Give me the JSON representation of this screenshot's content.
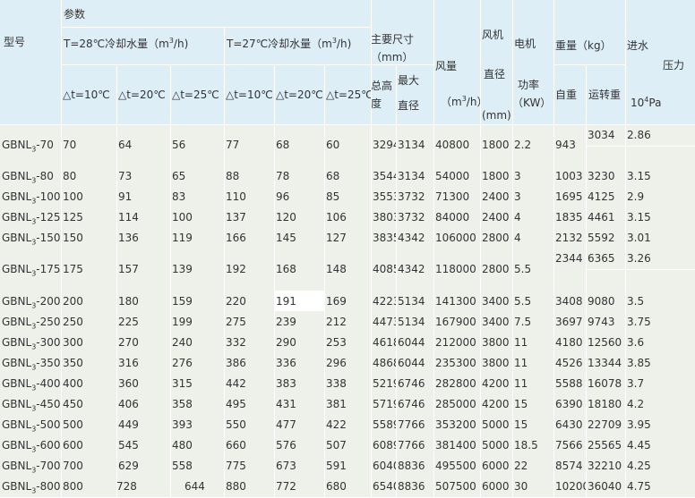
{
  "header": {
    "model": "型号",
    "params": "参数",
    "t28_prefix": "T=28℃冷却水量（m",
    "t28_suffix": "/h)",
    "t27_prefix": "T=27℃冷却水量（m",
    "t27_suffix": "/h)",
    "sup3": "3",
    "dt10": "△t=10℃",
    "dt20": "△t=20℃",
    "dt25": "△t=25℃",
    "main_size_1": "主要尺寸",
    "main_size_2": "（mm）",
    "total_height_1": "总高",
    "total_height_2": "度",
    "max_1": "最大",
    "max_2": "直径",
    "airflow_1": "风量",
    "airflow_2": "（m",
    "airflow_3": "/h）",
    "fan_1": "风机",
    "fan_2": "直径",
    "fan_3": "(mm)",
    "motor_1": "电机",
    "motor_2": "功率",
    "motor_3": "（KW）",
    "weight_1": "重量（kg）",
    "weight_self": "自重",
    "weight_run": "运转重",
    "inlet_1": "进水",
    "inlet_2": "压力",
    "inlet_3a": "10",
    "inlet_3sup": "4",
    "inlet_3b": "Pa"
  },
  "rows": [
    {
      "model": "GBNL3-70",
      "t28_10": "70",
      "t28_20": "64",
      "t28_25": "56",
      "t27_10": "77",
      "t27_20": "68",
      "t27_25": "60",
      "height": "3294",
      "diameter": "3134",
      "airflow": "40800",
      "fan_dia": "1800",
      "power": "2.2",
      "self_wt": "943",
      "run_wt": "3034",
      "pressure": "2.86"
    },
    {
      "model": "GBNL3-80",
      "t28_10": "80",
      "t28_20": "73",
      "t28_25": "65",
      "t27_10": "88",
      "t27_20": "78",
      "t27_25": "68",
      "height": "3544",
      "diameter": "3134",
      "airflow": "54000",
      "fan_dia": "1800",
      "power": "3",
      "self_wt": "1003",
      "run_wt": "3230",
      "pressure": "3.15"
    },
    {
      "model": "GBNL3-100",
      "t28_10": "100",
      "t28_20": "91",
      "t28_25": "83",
      "t27_10": "110",
      "t27_20": "96",
      "t27_25": "85",
      "height": "3553",
      "diameter": "3732",
      "airflow": "71300",
      "fan_dia": "2400",
      "power": "3",
      "self_wt": "1695",
      "run_wt": "4125",
      "pressure": "2.9"
    },
    {
      "model": "GBNL3-125",
      "t28_10": "125",
      "t28_20": "114",
      "t28_25": "100",
      "t27_10": "137",
      "t27_20": "120",
      "t27_25": "106",
      "height": "3803",
      "diameter": "3732",
      "airflow": "84000",
      "fan_dia": "2400",
      "power": "4",
      "self_wt": "1835",
      "run_wt": "4461",
      "pressure": "3.15"
    },
    {
      "model": "GBNL3-150",
      "t28_10": "150",
      "t28_20": "136",
      "t28_25": "119",
      "t27_10": "166",
      "t27_20": "145",
      "t27_25": "127",
      "height": "3835",
      "diameter": "4342",
      "airflow": "106000",
      "fan_dia": "2800",
      "power": "4",
      "self_wt": "2132",
      "run_wt": "5592",
      "pressure": "3.01"
    },
    {
      "model": "GBNL3-175",
      "t28_10": "175",
      "t28_20": "157",
      "t28_25": "139",
      "t27_10": "192",
      "t27_20": "168",
      "t27_25": "148",
      "height": "4085",
      "diameter": "4342",
      "airflow": "118000",
      "fan_dia": "2800",
      "power": "5.5",
      "self_wt": "2344",
      "run_wt": "6365",
      "pressure": "3.26"
    },
    {
      "model": "GBNL3-200",
      "t28_10": "200",
      "t28_20": "180",
      "t28_25": "159",
      "t27_10": "220",
      "t27_20": "191",
      "t27_25": "169",
      "height": "4223",
      "diameter": "5134",
      "airflow": "141300",
      "fan_dia": "3400",
      "power": "5.5",
      "self_wt": "3408",
      "run_wt": "9080",
      "pressure": "3.5"
    },
    {
      "model": "GBNL3-250",
      "t28_10": "250",
      "t28_20": "225",
      "t28_25": "199",
      "t27_10": "275",
      "t27_20": "239",
      "t27_25": "212",
      "height": "4473",
      "diameter": "5134",
      "airflow": "167900",
      "fan_dia": "3400",
      "power": "7.5",
      "self_wt": "3697",
      "run_wt": "9743",
      "pressure": "3.75"
    },
    {
      "model": "GBNL3-300",
      "t28_10": "300",
      "t28_20": "270",
      "t28_25": "240",
      "t27_10": "332",
      "t27_20": "290",
      "t27_25": "253",
      "height": "4618",
      "diameter": "6044",
      "airflow": "212000",
      "fan_dia": "3800",
      "power": "11",
      "self_wt": "4180",
      "run_wt": "12560",
      "pressure": "3.6"
    },
    {
      "model": "GBNL3-350",
      "t28_10": "350",
      "t28_20": "316",
      "t28_25": "276",
      "t27_10": "386",
      "t27_20": "336",
      "t27_25": "296",
      "height": "4868",
      "diameter": "6044",
      "airflow": "235300",
      "fan_dia": "3800",
      "power": "11",
      "self_wt": "4526",
      "run_wt": "13344",
      "pressure": "3.85"
    },
    {
      "model": "GBNL3-400",
      "t28_10": "400",
      "t28_20": "360",
      "t28_25": "315",
      "t27_10": "442",
      "t27_20": "383",
      "t27_25": "338",
      "height": "5219",
      "diameter": "6746",
      "airflow": "282800",
      "fan_dia": "4200",
      "power": "11",
      "self_wt": "5588",
      "run_wt": "16078",
      "pressure": "3.7"
    },
    {
      "model": "GBNL3-450",
      "t28_10": "450",
      "t28_20": "406",
      "t28_25": "358",
      "t27_10": "495",
      "t27_20": "431",
      "t27_25": "381",
      "height": "5719",
      "diameter": "6746",
      "airflow": "285000",
      "fan_dia": "4200",
      "power": "15",
      "self_wt": "6390",
      "run_wt": "18180",
      "pressure": "4.2"
    },
    {
      "model": "GBNL3-500",
      "t28_10": "500",
      "t28_20": "449",
      "t28_25": "393",
      "t27_10": "550",
      "t27_20": "477",
      "t27_25": "422",
      "height": "5589",
      "diameter": "7766",
      "airflow": "353200",
      "fan_dia": "5000",
      "power": "15",
      "self_wt": "6430",
      "run_wt": "22709",
      "pressure": "3.95"
    },
    {
      "model": "GBNL3-600",
      "t28_10": "600",
      "t28_20": "545",
      "t28_25": "480",
      "t27_10": "660",
      "t27_20": "576",
      "t27_25": "507",
      "height": "6089",
      "diameter": "7766",
      "airflow": "381400",
      "fan_dia": "5000",
      "power": "18.5",
      "self_wt": "7566",
      "run_wt": "25565",
      "pressure": "4.45"
    },
    {
      "model": "GBNL3-700",
      "t28_10": "700",
      "t28_20": "629",
      "t28_25": "558",
      "t27_10": "775",
      "t27_20": "673",
      "t27_25": "591",
      "height": "6040",
      "diameter": "8836",
      "airflow": "495500",
      "fan_dia": "6000",
      "power": "22",
      "self_wt": "8574",
      "run_wt": "32210",
      "pressure": "4.25"
    },
    {
      "model": "GBNL3-800",
      "t28_10": "800",
      "t28_20": "728",
      "t28_25": "644",
      "t27_10": "880",
      "t27_20": "772",
      "t27_25": "680",
      "height": "6540",
      "diameter": "8836",
      "airflow": "507500",
      "fan_dia": "6000",
      "power": "30",
      "self_wt": "10200",
      "run_wt": "36040",
      "pressure": "4.75"
    }
  ]
}
